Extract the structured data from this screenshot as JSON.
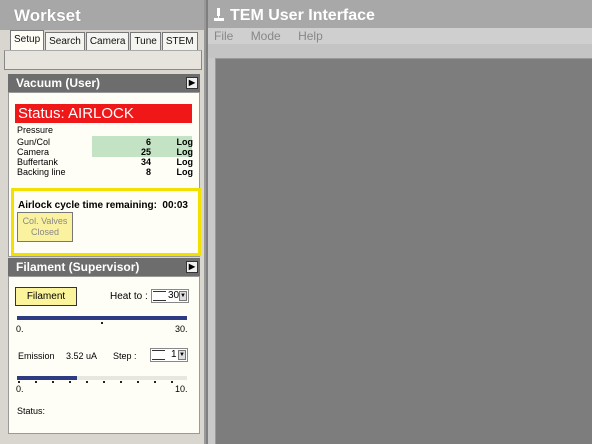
{
  "workset": {
    "title": "Workset",
    "tabs": [
      "Setup",
      "Search",
      "Camera",
      "Tune",
      "STEM"
    ]
  },
  "vacuum": {
    "header": "Vacuum (User)",
    "status": "Status:  AIRLOCK",
    "pressure_label": "Pressure",
    "rows": [
      {
        "label": "Gun/Col",
        "value": "6",
        "unit": "Log"
      },
      {
        "label": "Camera",
        "value": "25",
        "unit": "Log"
      },
      {
        "label": "Buffertank",
        "value": "34",
        "unit": "Log"
      },
      {
        "label": "Backing line",
        "value": "8",
        "unit": "Log"
      }
    ],
    "airlock_label": "Airlock cycle time remaining:",
    "airlock_time": "00:03",
    "col_valves": "Col. Valves\nClosed"
  },
  "filament": {
    "header": "Filament (Supervisor)",
    "button": "Filament",
    "heat_label": "Heat to :",
    "heat_value": "30",
    "scale_min": "0.",
    "scale_max": "30.",
    "emission_label": "Emission",
    "emission_value": "3.52  uA",
    "step_label": "Step :",
    "step_value": "1",
    "scale2_min": "0.",
    "scale2_max": "10.",
    "status_label": "Status:",
    "heat_fraction": 1.0,
    "emission_fraction": 0.35
  },
  "tem": {
    "title": "TEM User Interface",
    "menu": [
      "File",
      "Mode",
      "Help"
    ]
  },
  "colors": {
    "status_red": "#ef1717",
    "airlock_border": "#f2e000",
    "track_blue": "#2e3a82",
    "pressure_green": "#c4e2c4"
  }
}
